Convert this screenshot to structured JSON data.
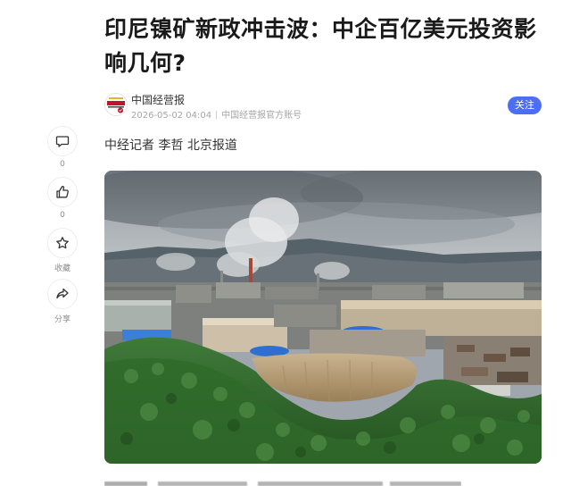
{
  "article": {
    "title_line1": "印尼镍矿新政冲击波：中企百亿美元投资影",
    "title_line2": "响几何?",
    "byline": "中经记者 李哲 北京报道"
  },
  "author": {
    "name": "中国经营报",
    "timestamp": "2026-05-02 04:04",
    "account_type": "中国经营报官方账号",
    "follow_label": "关注",
    "avatar_text": "中國經營報"
  },
  "actions": {
    "comment": {
      "icon": "comment-icon",
      "count": "0"
    },
    "like": {
      "icon": "thumbs-up-icon",
      "count": "0"
    },
    "favorite": {
      "icon": "star-icon",
      "label": "收藏"
    },
    "share": {
      "icon": "share-icon",
      "label": "分享"
    }
  },
  "photo": {
    "subject": "aerial view of nickel smelting industrial park among green hills"
  },
  "colors": {
    "accent": "#4c6ef5",
    "text": "#222222",
    "muted": "#a6a6a6"
  }
}
